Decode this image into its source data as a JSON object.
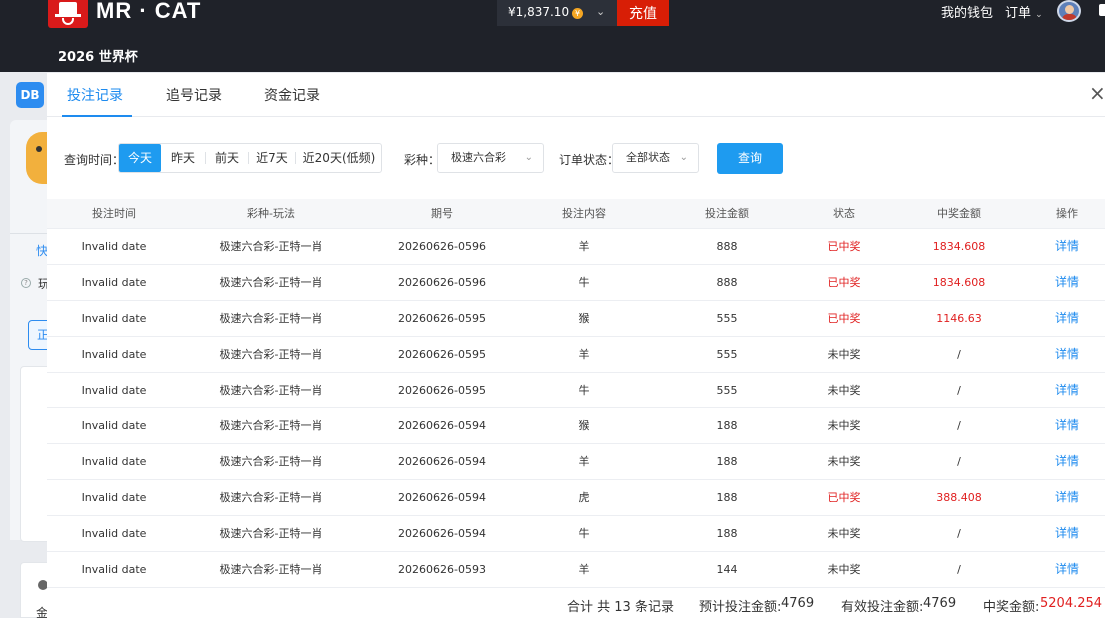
{
  "header": {
    "brand": "MR · CAT",
    "balance": "¥1,837.10",
    "coin_symbol": "¥",
    "recharge_label": "充值",
    "wallet_label": "我的钱包",
    "order_label": "订单",
    "sub_nav": "2026 世界杯"
  },
  "background": {
    "logo_text": "DB",
    "frag_kuai": "快",
    "frag_wan": "玩",
    "frag_zheng": "正",
    "frag_jin": "金"
  },
  "modal": {
    "tabs": [
      "投注记录",
      "追号记录",
      "资金记录"
    ],
    "active_tab": 0,
    "close_symbol": "×"
  },
  "filters": {
    "time_label": "查询时间：",
    "time_ranges": [
      "今天",
      "昨天",
      "前天",
      "近7天",
      "近20天(低频)"
    ],
    "active_range": 0,
    "lottery_label": "彩种：",
    "lottery_value": "极速六合彩",
    "status_label": "订单状态：",
    "status_value": "全部状态",
    "query_label": "查询"
  },
  "table": {
    "columns": [
      "投注时间",
      "彩种-玩法",
      "期号",
      "投注内容",
      "投注金额",
      "状态",
      "中奖金额",
      "操作"
    ],
    "rows": [
      {
        "time": "Invalid date",
        "game": "极速六合彩-正特一肖",
        "issue": "20260626-0596",
        "content": "羊",
        "amount": "888",
        "status": "已中奖",
        "win": true,
        "prize": "1834.608",
        "action": "详情"
      },
      {
        "time": "Invalid date",
        "game": "极速六合彩-正特一肖",
        "issue": "20260626-0596",
        "content": "牛",
        "amount": "888",
        "status": "已中奖",
        "win": true,
        "prize": "1834.608",
        "action": "详情"
      },
      {
        "time": "Invalid date",
        "game": "极速六合彩-正特一肖",
        "issue": "20260626-0595",
        "content": "猴",
        "amount": "555",
        "status": "已中奖",
        "win": true,
        "prize": "1146.63",
        "action": "详情"
      },
      {
        "time": "Invalid date",
        "game": "极速六合彩-正特一肖",
        "issue": "20260626-0595",
        "content": "羊",
        "amount": "555",
        "status": "未中奖",
        "win": false,
        "prize": "/",
        "action": "详情"
      },
      {
        "time": "Invalid date",
        "game": "极速六合彩-正特一肖",
        "issue": "20260626-0595",
        "content": "牛",
        "amount": "555",
        "status": "未中奖",
        "win": false,
        "prize": "/",
        "action": "详情"
      },
      {
        "time": "Invalid date",
        "game": "极速六合彩-正特一肖",
        "issue": "20260626-0594",
        "content": "猴",
        "amount": "188",
        "status": "未中奖",
        "win": false,
        "prize": "/",
        "action": "详情"
      },
      {
        "time": "Invalid date",
        "game": "极速六合彩-正特一肖",
        "issue": "20260626-0594",
        "content": "羊",
        "amount": "188",
        "status": "未中奖",
        "win": false,
        "prize": "/",
        "action": "详情"
      },
      {
        "time": "Invalid date",
        "game": "极速六合彩-正特一肖",
        "issue": "20260626-0594",
        "content": "虎",
        "amount": "188",
        "status": "已中奖",
        "win": true,
        "prize": "388.408",
        "action": "详情"
      },
      {
        "time": "Invalid date",
        "game": "极速六合彩-正特一肖",
        "issue": "20260626-0594",
        "content": "牛",
        "amount": "188",
        "status": "未中奖",
        "win": false,
        "prize": "/",
        "action": "详情"
      },
      {
        "time": "Invalid date",
        "game": "极速六合彩-正特一肖",
        "issue": "20260626-0593",
        "content": "羊",
        "amount": "144",
        "status": "未中奖",
        "win": false,
        "prize": "/",
        "action": "详情"
      }
    ]
  },
  "summary": {
    "total_records": "合计 共 13 条记录",
    "expected_label": "预计投注金额:",
    "expected_value": "4769",
    "valid_label": "有效投注金额:",
    "valid_value": "4769",
    "prize_label": "中奖金额:",
    "prize_value": "5204.254"
  },
  "colors": {
    "accent": "#1e9bf0",
    "win_red": "#e02020",
    "recharge_red": "#d81e06",
    "topbar_bg": "#1f2229"
  }
}
